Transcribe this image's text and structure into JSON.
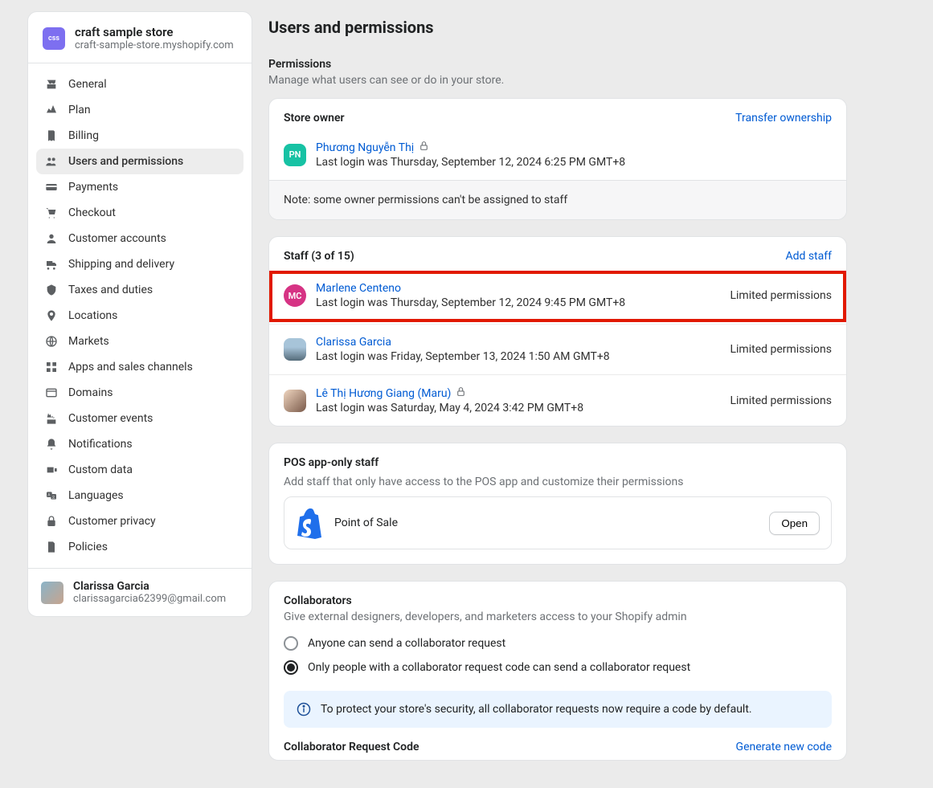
{
  "store": {
    "badge": "css",
    "name": "craft sample store",
    "domain": "craft-sample-store.myshopify.com"
  },
  "nav": {
    "items": [
      {
        "label": "General",
        "icon": "store"
      },
      {
        "label": "Plan",
        "icon": "plan"
      },
      {
        "label": "Billing",
        "icon": "billing"
      },
      {
        "label": "Users and permissions",
        "icon": "users"
      },
      {
        "label": "Payments",
        "icon": "payments"
      },
      {
        "label": "Checkout",
        "icon": "checkout"
      },
      {
        "label": "Customer accounts",
        "icon": "customer"
      },
      {
        "label": "Shipping and delivery",
        "icon": "shipping"
      },
      {
        "label": "Taxes and duties",
        "icon": "taxes"
      },
      {
        "label": "Locations",
        "icon": "locations"
      },
      {
        "label": "Markets",
        "icon": "markets"
      },
      {
        "label": "Apps and sales channels",
        "icon": "apps"
      },
      {
        "label": "Domains",
        "icon": "domains"
      },
      {
        "label": "Customer events",
        "icon": "events"
      },
      {
        "label": "Notifications",
        "icon": "notifications"
      },
      {
        "label": "Custom data",
        "icon": "customdata"
      },
      {
        "label": "Languages",
        "icon": "languages"
      },
      {
        "label": "Customer privacy",
        "icon": "privacy"
      },
      {
        "label": "Policies",
        "icon": "policies"
      }
    ],
    "active_index": 3
  },
  "current_user": {
    "name": "Clarissa Garcia",
    "email": "clarissagarcia62399@gmail.com"
  },
  "page": {
    "title": "Users and permissions",
    "permissions_heading": "Permissions",
    "permissions_desc": "Manage what users can see or do in your store."
  },
  "owner_card": {
    "title": "Store owner",
    "transfer_link": "Transfer ownership",
    "owner": {
      "initials": "PN",
      "name": "Phương Nguyễn Thị",
      "locked": true,
      "last_login": "Last login was Thursday, September 12, 2024 6:25 PM GMT+8"
    },
    "note": "Note: some owner permissions can't be assigned to staff"
  },
  "staff_card": {
    "title": "Staff (3 of 15)",
    "add_link": "Add staff",
    "members": [
      {
        "initials": "MC",
        "name": "Marlene Centeno",
        "last_login": "Last login was Thursday, September 12, 2024 9:45 PM GMT+8",
        "perm": "Limited permissions",
        "avatar": "magenta",
        "highlighted": true,
        "locked": false
      },
      {
        "initials": "",
        "name": "Clarissa Garcia",
        "last_login": "Last login was Friday, September 13, 2024 1:50 AM GMT+8",
        "perm": "Limited permissions",
        "avatar": "photo1",
        "highlighted": false,
        "locked": false
      },
      {
        "initials": "",
        "name": "Lê Thị Hương Giang (Maru)",
        "last_login": "Last login was Saturday, May 4, 2024 3:42 PM GMT+8",
        "perm": "Limited permissions",
        "avatar": "photo2",
        "highlighted": false,
        "locked": true
      }
    ]
  },
  "pos_card": {
    "title": "POS app-only staff",
    "desc": "Add staff that only have access to the POS app and customize their permissions",
    "app_label": "Point of Sale",
    "open_label": "Open"
  },
  "collab_card": {
    "title": "Collaborators",
    "desc": "Give external designers, developers, and marketers access to your Shopify admin",
    "option_anyone": "Anyone can send a collaborator request",
    "option_code": "Only people with a collaborator request code can send a collaborator request",
    "selected": "code",
    "info": "To protect your store's security, all collaborator requests now require a code by default.",
    "code_label": "Collaborator Request Code",
    "generate_link": "Generate new code"
  }
}
